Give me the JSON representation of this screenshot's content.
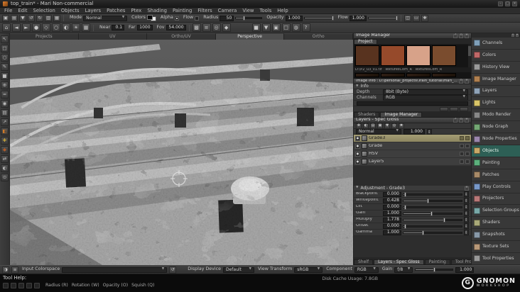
{
  "window": {
    "title": "top_train* - Mari Non-commercial"
  },
  "menu": {
    "items": [
      {
        "label": "File"
      },
      {
        "label": "Edit"
      },
      {
        "label": "Selection"
      },
      {
        "label": "Objects"
      },
      {
        "label": "Layers"
      },
      {
        "label": "Patches"
      },
      {
        "label": "Ptex"
      },
      {
        "label": "Shading"
      },
      {
        "label": "Painting"
      },
      {
        "label": "Filters"
      },
      {
        "label": "Camera"
      },
      {
        "label": "View"
      },
      {
        "label": "Tools"
      },
      {
        "label": "Help"
      }
    ]
  },
  "paint_toolbar": {
    "icons": [
      {
        "name": "new-project-icon",
        "glyph": "▣"
      },
      {
        "name": "open-project-icon",
        "glyph": "▤"
      },
      {
        "name": "save-project-icon",
        "glyph": "▼"
      },
      {
        "name": "undo-icon",
        "glyph": "↺"
      },
      {
        "name": "redo-icon",
        "glyph": "↻"
      },
      {
        "name": "copy-icon",
        "glyph": "▥"
      },
      {
        "name": "paste-icon",
        "glyph": "▦"
      }
    ],
    "mode_label": "Mode",
    "mode_value": "Normal",
    "colors_label": "Colors",
    "alpha_label": "Alpha",
    "flow_toggle_label": "Flow",
    "radius_label": "Radius",
    "radius_value": "50",
    "radius_pct": 30,
    "opacity_label": "Opacity",
    "opacity_value": "1.000",
    "opacity_pct": 100,
    "flow_label": "Flow",
    "flow_value": "1.000",
    "flow_pct": 100,
    "right_icons": [
      {
        "name": "symmetry-icon",
        "glyph": "◫"
      },
      {
        "name": "paint-buffer-icon",
        "glyph": "▭"
      },
      {
        "name": "color-picker-icon",
        "glyph": "✚"
      }
    ]
  },
  "camera_toolbar": {
    "tools": [
      {
        "name": "camera-home-icon",
        "glyph": "⌂"
      },
      {
        "name": "camera-prev-icon",
        "glyph": "◄"
      },
      {
        "name": "camera-next-icon",
        "glyph": "►"
      },
      {
        "name": "lock-view-icon",
        "glyph": "●"
      },
      {
        "name": "perspective-view-icon",
        "glyph": "◇"
      },
      {
        "name": "flat-lighting-icon",
        "glyph": "○"
      },
      {
        "name": "basic-lighting-icon",
        "glyph": "◐"
      },
      {
        "name": "full-lighting-icon",
        "glyph": "☀"
      },
      {
        "name": "shadow-toggle-icon",
        "glyph": "▦"
      }
    ],
    "near_label": "Near",
    "near_value": "0.1",
    "far_label": "Far",
    "far_value": "1000",
    "fov_label": "Fov",
    "fov_value": "54.000",
    "mid_icons": [
      {
        "name": "wireframe-toggle-icon",
        "glyph": "▩"
      },
      {
        "name": "hud-toggle-icon",
        "glyph": "≡"
      },
      {
        "name": "snapshot-icon",
        "glyph": "◎"
      },
      {
        "name": "mirror-projection-icon",
        "glyph": "◆"
      }
    ],
    "right_icons": [
      {
        "name": "pause-baking-icon",
        "glyph": "■"
      },
      {
        "name": "bake-icon",
        "glyph": "▼"
      },
      {
        "name": "screenshot-icon",
        "glyph": "▣"
      },
      {
        "name": "isolate-select-icon",
        "glyph": "□"
      },
      {
        "name": "fade-objects-icon",
        "glyph": "◍"
      },
      {
        "name": "help-mode-icon",
        "glyph": "?"
      }
    ]
  },
  "left_tools": {
    "tools": [
      {
        "name": "select-tool-icon",
        "glyph": "↖",
        "color": "#bdbdbd"
      },
      {
        "name": "marquee-select-tool-icon",
        "glyph": "□",
        "color": "#bdbdbd"
      },
      {
        "name": "lasso-select-tool-icon",
        "glyph": "○",
        "color": "#bdbdbd"
      },
      {
        "name": "paint-brush-tool-icon",
        "glyph": "✎",
        "color": "#bdbdbd"
      },
      {
        "name": "eraser-tool-icon",
        "glyph": "■",
        "color": "#bdbdbd"
      },
      {
        "name": "clone-stamp-tool-icon",
        "glyph": "⊕",
        "color": "#bdbdbd"
      },
      {
        "name": "smear-tool-icon",
        "glyph": "≈",
        "color": "#bdbdbd"
      },
      {
        "name": "blur-tool-icon",
        "glyph": "◉",
        "color": "#bdbdbd"
      },
      {
        "name": "gradient-tool-icon",
        "glyph": "▤",
        "color": "#bdbdbd"
      },
      {
        "name": "vector-paint-tool-icon",
        "glyph": "↗",
        "color": "#bdbdbd"
      },
      {
        "name": "paint-through-tool-icon",
        "glyph": "◧",
        "color": "#d07a28"
      },
      {
        "name": "warp-tool-icon",
        "glyph": "✚",
        "color": "#c8a838"
      },
      {
        "name": "pinup-tool-icon",
        "glyph": "◆",
        "color": "#b05a28"
      },
      {
        "name": "transform-paint-tool-icon",
        "glyph": "⇄",
        "color": "#bdbdbd"
      },
      {
        "name": "slerp-tool-icon",
        "glyph": "◐",
        "color": "#bdbdbd"
      },
      {
        "name": "zoom-tool-icon",
        "glyph": "⊙",
        "color": "#bdbdbd"
      }
    ]
  },
  "viewport": {
    "tabs": [
      {
        "label": "Projects",
        "active": false
      },
      {
        "label": "UV",
        "active": false
      },
      {
        "label": "Ortho/UV",
        "active": false
      },
      {
        "label": "Perspective",
        "active": true
      },
      {
        "label": "Ortho",
        "active": false
      }
    ]
  },
  "image_manager": {
    "title": "Image Manager",
    "project_tab": "Project",
    "thumbs": [
      {
        "name": "texture-thumb-1",
        "color": "#58331f"
      },
      {
        "name": "texture-thumb-2",
        "color": "#964a2b"
      },
      {
        "name": "texture-thumb-3",
        "color": "#d7a289"
      },
      {
        "name": "texture-thumb-4",
        "color": "#7a4c2e"
      }
    ],
    "file_labels": [
      {
        "label": "D:\\P2_u3_v1.tif"
      },
      {
        "label": "TexturesCom_R"
      },
      {
        "label": "TexturesCom_R"
      }
    ]
  },
  "image_info": {
    "title": "Image Info : D:\\personal_projects\\Train_tutorial\\mari_bsp_textures\\Textu",
    "info_section_label": "Info",
    "depth_label": "Depth",
    "depth_value": "8bit (Byte)",
    "channels_label": "Channels",
    "channels_value": "RGB"
  },
  "mid_dock_tabs": [
    {
      "label": "Shaders",
      "active": false
    },
    {
      "label": "Image Manager",
      "active": true
    }
  ],
  "layers_panel": {
    "title": "Layers - Spec Gloss",
    "filter_icons": [
      {
        "name": "add-paint-layer-icon",
        "glyph": "✚"
      },
      {
        "name": "add-adjustment-layer-icon",
        "glyph": "◐"
      },
      {
        "name": "add-procedural-layer-icon",
        "glyph": "▤"
      },
      {
        "name": "add-group-layer-icon",
        "glyph": "▣"
      },
      {
        "name": "merge-layers-icon",
        "glyph": "▼"
      },
      {
        "name": "add-mask-icon",
        "glyph": "◎"
      },
      {
        "name": "remove-layer-icon",
        "glyph": "✖"
      }
    ],
    "blend_mode": "Normal",
    "amount": "1.000",
    "layers": [
      {
        "name": "Grade3",
        "selected": true
      },
      {
        "name": "Grade",
        "selected": false
      },
      {
        "name": "HSV",
        "selected": false
      },
      {
        "name": "Layer5",
        "selected": false
      }
    ]
  },
  "adjustment_panel": {
    "title": "Adjustment - Grade3",
    "sliders": [
      {
        "label": "Blackpoint",
        "value": "0.000",
        "pct": 2
      },
      {
        "label": "Whitepoint",
        "value": "0.428",
        "pct": 42
      },
      {
        "label": "Lift",
        "value": "0.000",
        "pct": 2
      },
      {
        "label": "Gain",
        "value": "1.000",
        "pct": 48
      },
      {
        "label": "Multiply",
        "value": "1.778",
        "pct": 70
      },
      {
        "label": "Offset",
        "value": "0.000",
        "pct": 2
      },
      {
        "label": "Gamma",
        "value": "1.000",
        "pct": 33
      }
    ]
  },
  "bottom_dock_tabs": [
    {
      "label": "Shelf",
      "active": false
    },
    {
      "label": "Layers - Spec Gloss",
      "active": true
    },
    {
      "label": "Painting",
      "active": false
    },
    {
      "label": "Tool Properties",
      "active": false
    }
  ],
  "palettes": {
    "items": [
      {
        "label": "Channels",
        "icon": "channels-icon",
        "color": "#7f9fb8",
        "active": false
      },
      {
        "label": "Colors",
        "icon": "colors-icon",
        "color": "#c06868",
        "active": false
      },
      {
        "label": "History View",
        "icon": "history-view-icon",
        "color": "#9a9a9a",
        "active": false
      },
      {
        "label": "Image Manager",
        "icon": "image-manager-icon",
        "color": "#b08050",
        "active": false
      },
      {
        "label": "Layers",
        "icon": "layers-icon",
        "color": "#8fa3b8",
        "active": false
      },
      {
        "label": "Lights",
        "icon": "lights-icon",
        "color": "#d8c468",
        "active": false
      },
      {
        "label": "Modo Render",
        "icon": "modo-render-icon",
        "color": "#888888",
        "active": false
      },
      {
        "label": "Node Graph",
        "icon": "node-graph-icon",
        "color": "#74a874",
        "active": false
      },
      {
        "label": "Node Properties",
        "icon": "node-properties-icon",
        "color": "#9a86ac",
        "active": false
      },
      {
        "label": "Objects",
        "icon": "objects-icon",
        "color": "#c8a868",
        "active": true
      },
      {
        "label": "Painting",
        "icon": "painting-icon",
        "color": "#5cb07c",
        "active": false
      },
      {
        "label": "Patches",
        "icon": "patches-icon",
        "color": "#a88a68",
        "active": false
      },
      {
        "label": "Play Controls",
        "icon": "play-controls-icon",
        "color": "#7898c8",
        "active": false
      },
      {
        "label": "Projectors",
        "icon": "projectors-icon",
        "color": "#b87878",
        "active": false
      },
      {
        "label": "Selection Groups",
        "icon": "selection-groups-icon",
        "color": "#78a8a8",
        "active": false
      },
      {
        "label": "Shaders",
        "icon": "shaders-icon",
        "color": "#a8a878",
        "active": false
      },
      {
        "label": "Snapshots",
        "icon": "snapshots-icon",
        "color": "#8898a8",
        "active": false
      },
      {
        "label": "Texture Sets",
        "icon": "texture-sets-icon",
        "color": "#b89878",
        "active": false
      },
      {
        "label": "Tool Properties",
        "icon": "tool-properties-icon",
        "color": "#989898",
        "active": false
      }
    ]
  },
  "colorspace_bar": {
    "input_label": "Input Colorspace",
    "display_device_label": "Display Device",
    "display_device_value": "Default",
    "view_transform_label": "View Transform",
    "view_transform_value": "sRGB",
    "component_label": "Component",
    "component_value": "RGB",
    "gain_label": "Gain",
    "gain_fstop": "f/8",
    "gain_amount": "1.000",
    "gain_pct": 50
  },
  "status_bar": {
    "tool_help_label": "Tool Help:",
    "shortcuts": [
      {
        "label": "Radius (R)"
      },
      {
        "label": "Rotation (W)"
      },
      {
        "label": "Opacity (O)"
      },
      {
        "label": "Squish (Q)"
      }
    ],
    "disk_cache": "Disk Cache Usage: 7.8GB",
    "logo": {
      "monogram": "G",
      "line1": "GNOMON",
      "line2": "WORKSHOP"
    }
  }
}
